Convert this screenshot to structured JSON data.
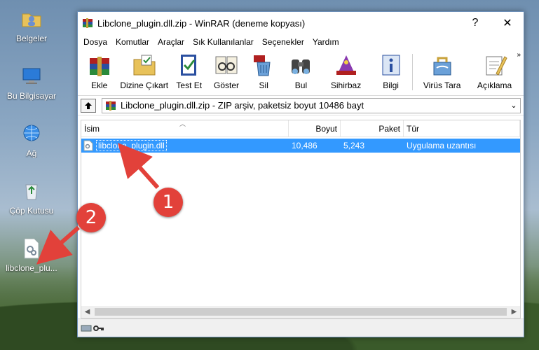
{
  "desktop": {
    "icons": [
      {
        "label": "Belgeler",
        "icon": "folder-user-icon"
      },
      {
        "label": "Bu Bilgisayar",
        "icon": "computer-icon"
      },
      {
        "label": "Ağ",
        "icon": "network-icon"
      },
      {
        "label": "Çöp Kutusu",
        "icon": "recycle-bin-icon"
      },
      {
        "label": "libclone_plu...",
        "icon": "dll-file-icon"
      }
    ]
  },
  "window": {
    "title": "Libclone_plugin.dll.zip - WinRAR (deneme kopyası)",
    "help_label": "?",
    "close_label": "✕",
    "menu": [
      "Dosya",
      "Komutlar",
      "Araçlar",
      "Sık Kullanılanlar",
      "Seçenekler",
      "Yardım"
    ],
    "toolbar": [
      {
        "label": "Ekle",
        "icon": "add-archive-icon"
      },
      {
        "label": "Dizine Çıkart",
        "icon": "extract-to-icon"
      },
      {
        "label": "Test Et",
        "icon": "test-icon"
      },
      {
        "label": "Göster",
        "icon": "view-icon"
      },
      {
        "label": "Sil",
        "icon": "delete-icon"
      },
      {
        "label": "Bul",
        "icon": "find-icon"
      },
      {
        "label": "Sihirbaz",
        "icon": "wizard-icon"
      },
      {
        "label": "Bilgi",
        "icon": "info-icon"
      },
      {
        "label": "Virüs Tara",
        "icon": "virus-scan-icon"
      },
      {
        "label": "Açıklama",
        "icon": "comment-icon"
      }
    ],
    "more_label": "»",
    "address": "Libclone_plugin.dll.zip - ZIP arşiv, paketsiz boyut 10486 bayt",
    "columns": [
      "İsim",
      "Boyut",
      "Paket",
      "Tür"
    ],
    "rows": [
      {
        "name": "libclone_plugin.dll",
        "size": "10,486",
        "packed": "5,243",
        "type": "Uygulama uzantısı"
      }
    ]
  },
  "annotations": {
    "badge1": "1",
    "badge2": "2"
  },
  "colors": {
    "selection": "#3399ff",
    "badge": "#e2413a",
    "winrar_red": "#b02020"
  }
}
